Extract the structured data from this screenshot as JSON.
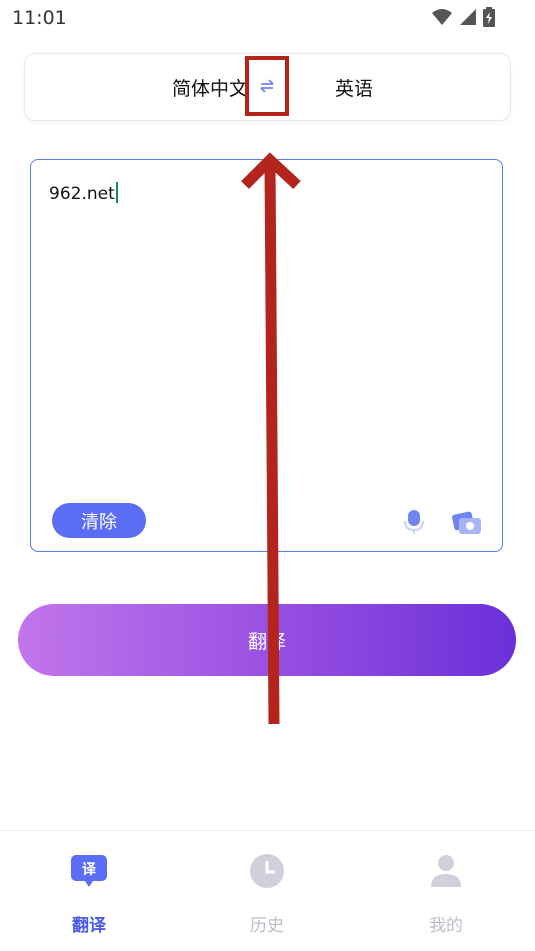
{
  "status_bar": {
    "time": "11:01"
  },
  "language_bar": {
    "source_language": "简体中文",
    "target_language": "英语"
  },
  "input": {
    "text": "962.net",
    "clear_label": "清除"
  },
  "translate_button": {
    "label": "翻译"
  },
  "bottom_nav": {
    "items": [
      {
        "label": "翻译",
        "icon_text": "译",
        "icon": "translate-bubble-icon",
        "active": true
      },
      {
        "label": "历史",
        "icon": "clock-icon",
        "active": false
      },
      {
        "label": "我的",
        "icon": "user-icon",
        "active": false
      }
    ]
  },
  "colors": {
    "accent": "#5b6cf5",
    "input_border": "#5b7bf2",
    "annotation": "#b3241d",
    "gradient_start": "#c176ec",
    "gradient_end": "#6b2fd9",
    "nav_active": "#4b5be8",
    "nav_inactive": "#bdbdc6"
  }
}
